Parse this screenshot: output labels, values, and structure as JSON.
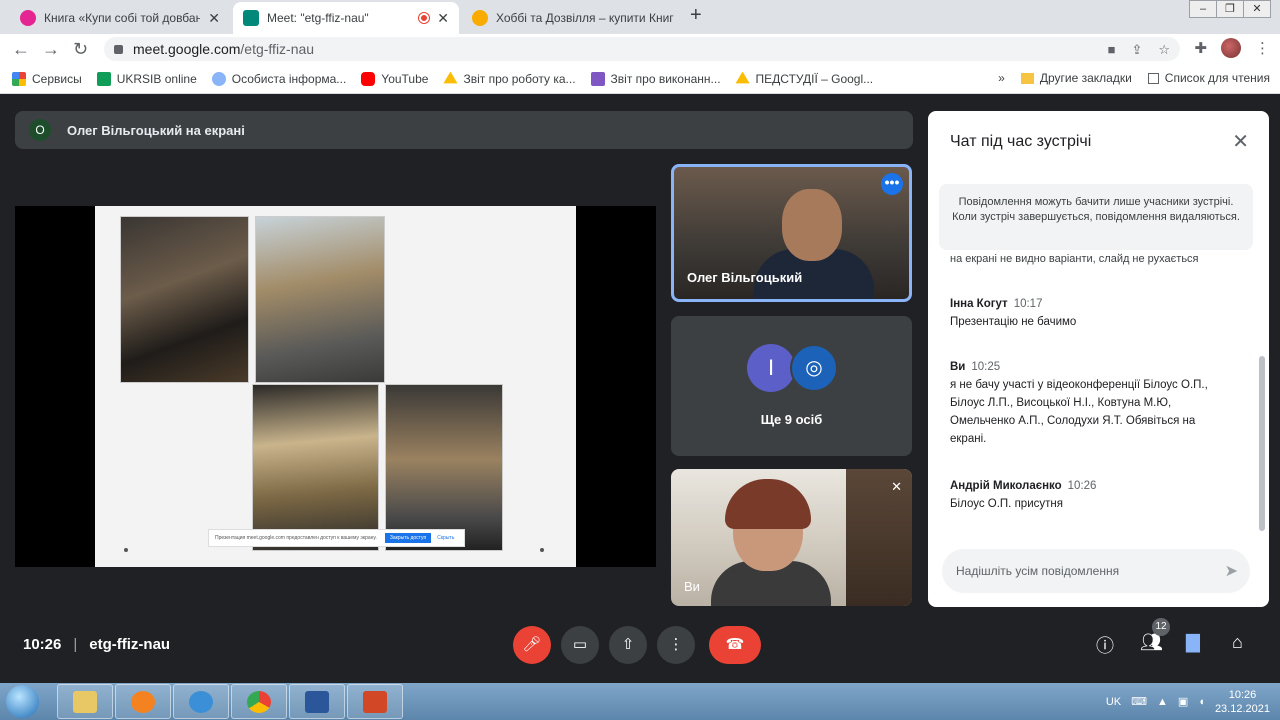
{
  "browser": {
    "tabs": [
      {
        "title": "Книга «Купи собі той довбаний",
        "color": "#e52592"
      },
      {
        "title": "Meet: \"etg-ffiz-nau\"",
        "color": "#00897b"
      },
      {
        "title": "Хоббі та Дозвілля – купити Книг",
        "color": "#f9ab00"
      }
    ],
    "url_host": "meet.google.com",
    "url_path": "/etg-ffiz-nau",
    "bookmarks": [
      {
        "label": "Сервисы",
        "color": "#ea4335"
      },
      {
        "label": "UKRSIB online",
        "color": "#0f9d58"
      },
      {
        "label": "Особиста інформа...",
        "color": "#8ab4f8"
      },
      {
        "label": "YouTube",
        "color": "#ff0000"
      },
      {
        "label": "Звіт про роботу ка...",
        "color": "#fbbc04"
      },
      {
        "label": "Звіт про виконанн...",
        "color": "#7e57c2"
      },
      {
        "label": "ПЕДСТУДІЇ – Googl...",
        "color": "#fbbc04"
      }
    ],
    "other_bookmarks": "Другие закладки",
    "reading_list": "Список для чтения",
    "overflow": "»"
  },
  "meet": {
    "presenting_badge": "О",
    "presenting_text": "Олег Вільгоцький на екрані",
    "share_notice": "Презентация meet.google.com предоставлен доступ к вашему экрану.",
    "share_stop": "Закрыть доступ",
    "share_hide": "Скрыть",
    "tile1_name": "Олег Вільгоцький",
    "tile2_avatar": "І",
    "tile2_more": "Ще 9 осіб",
    "tile3_name": "Ви",
    "time": "10:26",
    "separator": "|",
    "meeting_code": "etg-ffiz-nau",
    "participants_count": "12"
  },
  "chat": {
    "title": "Чат під час зустрічі",
    "notice": "Повідомлення можуть бачити лише учасники зустрічі. Коли зустріч завершується, повідомлення видаляються.",
    "cut_text": "на екрані не видно варіанти, слайд не рухається",
    "messages": [
      {
        "who": "Інна Когут",
        "time": "10:17",
        "text": "Презентацію не бачимо"
      },
      {
        "who": "Ви",
        "time": "10:25",
        "text": "я не бачу участі у відеоконференції Білоус О.П., Білоус Л.П., Висоцької Н.І., Ковтуна М.Ю, Омельченко А.П., Солодухи Я.Т. Обявіться на екрані."
      },
      {
        "who": "Андрій Миколаєнко",
        "time": "10:26",
        "text": "Білоус О.П. присутня"
      }
    ],
    "input_placeholder": "Надішліть усім повідомлення"
  },
  "taskbar": {
    "lang": "UK",
    "time": "10:26",
    "date": "23.12.2021"
  }
}
